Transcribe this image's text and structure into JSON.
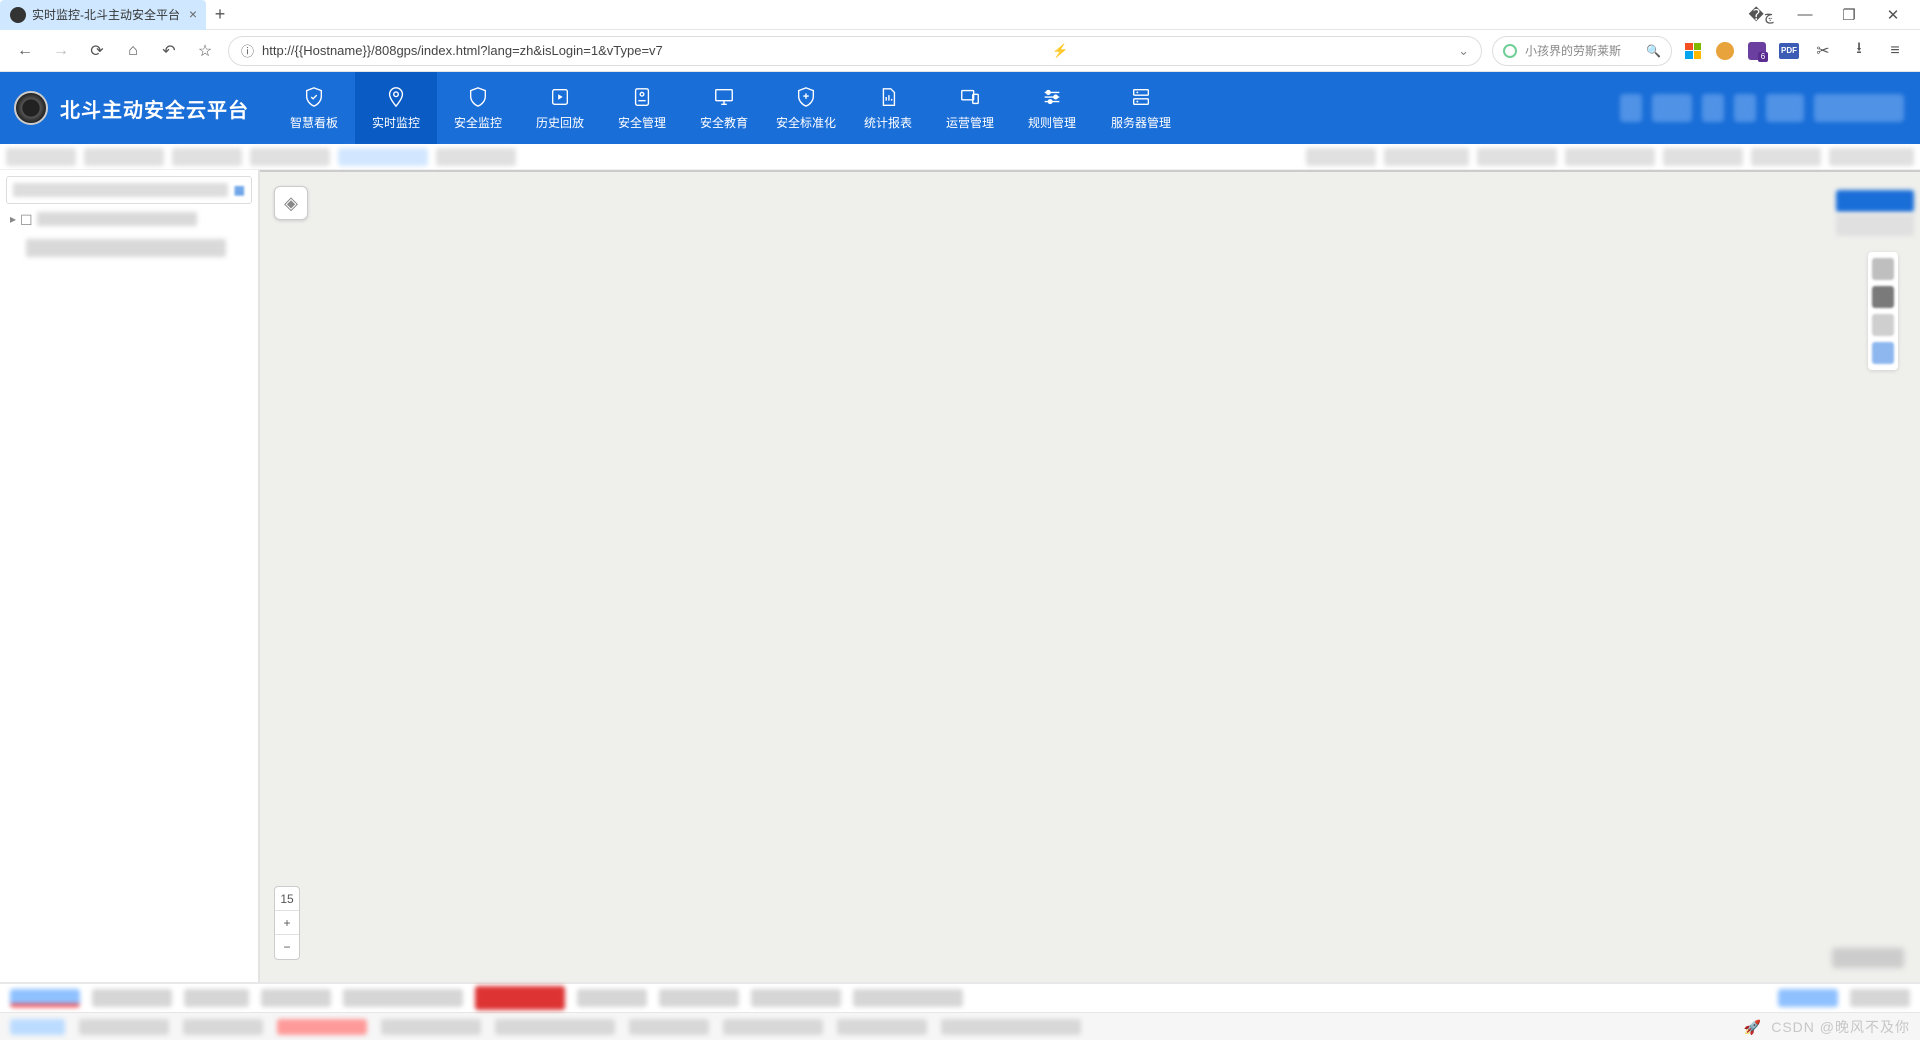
{
  "browser": {
    "tab_title": "实时监控-北斗主动安全平台",
    "url": "http://{{Hostname}}/808gps/index.html?lang=zh&isLogin=1&vType=v7",
    "search_placeholder": "小孩界的劳斯莱斯",
    "ext_pdf": "PDF"
  },
  "app": {
    "title": "北斗主动安全云平台"
  },
  "nav": [
    {
      "id": "dashboard",
      "label": "智慧看板"
    },
    {
      "id": "live",
      "label": "实时监控",
      "active": true
    },
    {
      "id": "safety",
      "label": "安全监控"
    },
    {
      "id": "history",
      "label": "历史回放"
    },
    {
      "id": "safemgr",
      "label": "安全管理"
    },
    {
      "id": "safeedu",
      "label": "安全教育"
    },
    {
      "id": "safestd",
      "label": "安全标准化"
    },
    {
      "id": "stats",
      "label": "统计报表"
    },
    {
      "id": "ops",
      "label": "运营管理"
    },
    {
      "id": "rules",
      "label": "规则管理"
    },
    {
      "id": "server",
      "label": "服务器管理"
    }
  ],
  "map": {
    "zoom_level": "15",
    "zoom_in": "+",
    "zoom_out": "−"
  },
  "watermark": "晚风不及你"
}
